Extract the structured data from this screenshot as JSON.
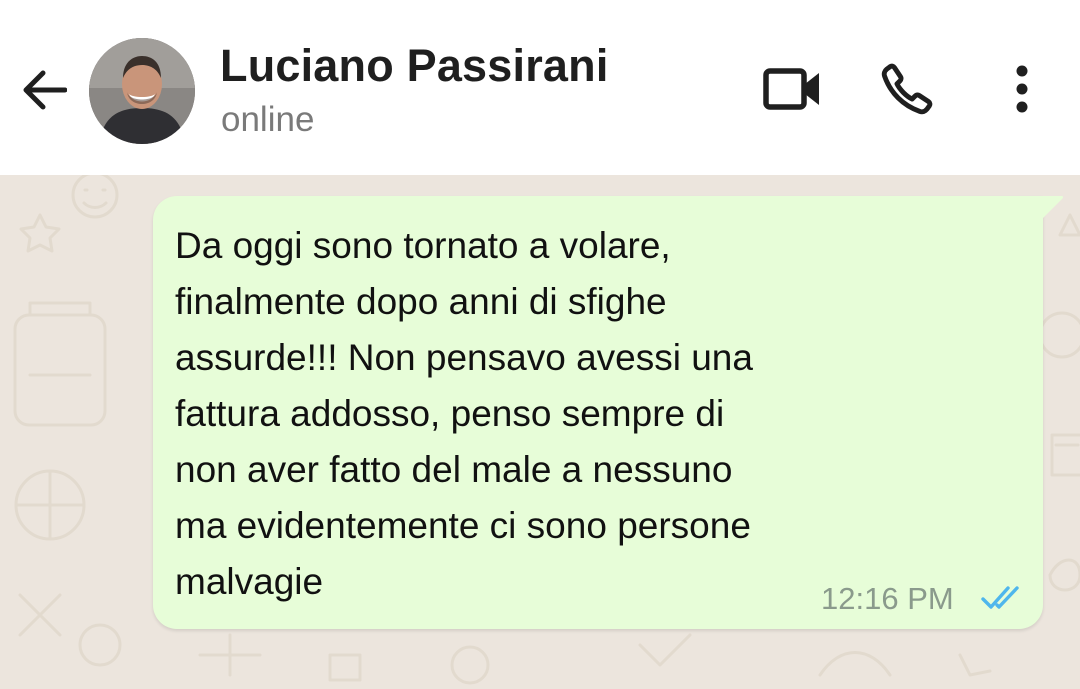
{
  "header": {
    "contact_name": "Luciano Passirani",
    "status": "online",
    "icons": {
      "back": "arrow-left-icon",
      "avatar": "profile-photo",
      "video": "video-camera-icon",
      "call": "phone-icon",
      "menu": "more-vertical-icon"
    }
  },
  "message": {
    "text": "Da oggi sono tornato a volare,\nfinalmente dopo anni di sfighe\nassurde!!! Non pensavo avessi una\nfattura addosso, penso sempre di\nnon aver fatto del male a nessuno\nma evidentemente ci sono persone\nmalvagie",
    "time": "12:16 PM",
    "status_icon": "double-check-read-icon"
  },
  "colors": {
    "header_bg": "#ffffff",
    "chat_bg": "#ece5dd",
    "bubble_bg": "#e7fdd8",
    "read_tick": "#4fb6ec",
    "name_text": "#1f1f1f",
    "status_text": "#7a7a7a"
  }
}
